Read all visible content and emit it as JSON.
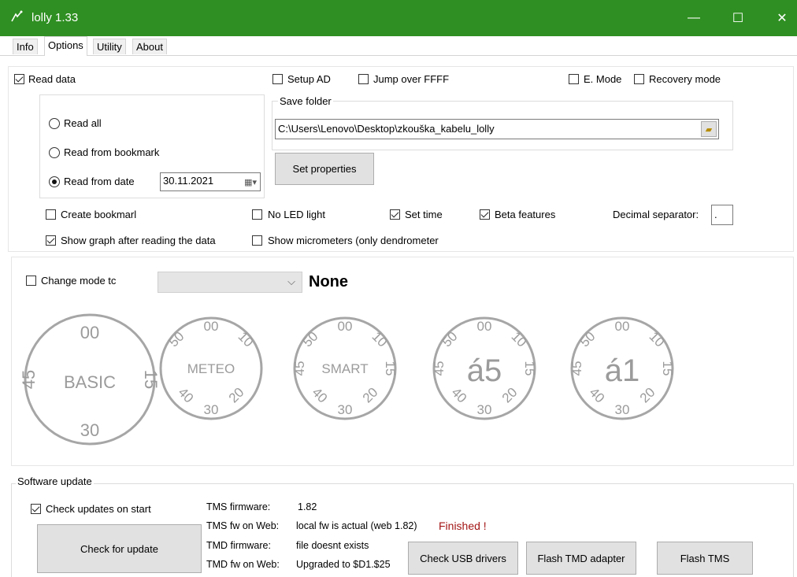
{
  "window": {
    "title": "lolly 1.33",
    "minimize": "—",
    "maximize": "☐",
    "close": "✕"
  },
  "tabs": [
    "Info",
    "Options",
    "Utility",
    "About"
  ],
  "options": {
    "read_data": "Read data",
    "setup_ad": "Setup AD",
    "jump_over": "Jump over FFFF",
    "e_mode": "E. Mode",
    "recovery_mode": "Recovery mode",
    "read_all": "Read all",
    "read_from_bookmark": "Read from bookmark",
    "read_from_date": "Read from date",
    "date_value": "30.11.2021",
    "save_folder_label": "Save folder",
    "save_folder_path": "C:\\Users\\Lenovo\\Desktop\\zkouška_kabelu_lolly",
    "set_properties": "Set properties",
    "create_bookmark": "Create bookmarl",
    "no_led": "No LED light",
    "set_time": "Set time",
    "beta_features": "Beta features",
    "decimal_separator_label": "Decimal separator:",
    "decimal_separator_value": ".",
    "show_graph": "Show graph after reading the data",
    "show_micrometers": "Show micrometers (only dendrometer"
  },
  "mode": {
    "change_mode": "Change mode tc",
    "dropdown_value": "",
    "current_mode": "None",
    "dials": [
      {
        "center": "BASIC",
        "top": "00",
        "left": "45",
        "right": "15",
        "bottom": "30"
      },
      {
        "center": "METEO",
        "top": "00",
        "tl": "50",
        "tr": "10",
        "bl": "40",
        "br": "20",
        "bottom": "30"
      },
      {
        "center": "SMART",
        "top": "00",
        "tl": "50",
        "tr": "10",
        "left": "45",
        "right": "15",
        "bl": "40",
        "br": "20",
        "bottom": "30"
      },
      {
        "center": "á5",
        "top": "00",
        "tl": "50",
        "tr": "10",
        "left": "45",
        "right": "15",
        "bl": "40",
        "br": "20",
        "bottom": "30"
      },
      {
        "center": "á1",
        "top": "00",
        "tl": "50",
        "tr": "10",
        "left": "45",
        "right": "15",
        "bl": "40",
        "br": "20",
        "bottom": "30"
      }
    ]
  },
  "update": {
    "section_label": "Software update",
    "check_on_start": "Check updates on start",
    "check_button": "Check for update",
    "tms_fw_label": "TMS firmware:",
    "tms_fw_value": "1.82",
    "tms_web_label": "TMS fw on Web:",
    "tms_web_value": "local fw is actual (web 1.82)",
    "finished": "Finished !",
    "tmd_fw_label": "TMD firmware:",
    "tmd_fw_value": "file  doesnt exists",
    "tmd_web_label": "TMD fw on Web:",
    "tmd_web_value": "Upgraded to $D1.$25",
    "check_usb": "Check USB drivers",
    "flash_tmd": "Flash TMD adapter",
    "flash_tms": "Flash TMS"
  },
  "colors": {
    "titlebar": "#2f8f22",
    "finished": "#a31515",
    "dial": "#9b9b9b"
  }
}
